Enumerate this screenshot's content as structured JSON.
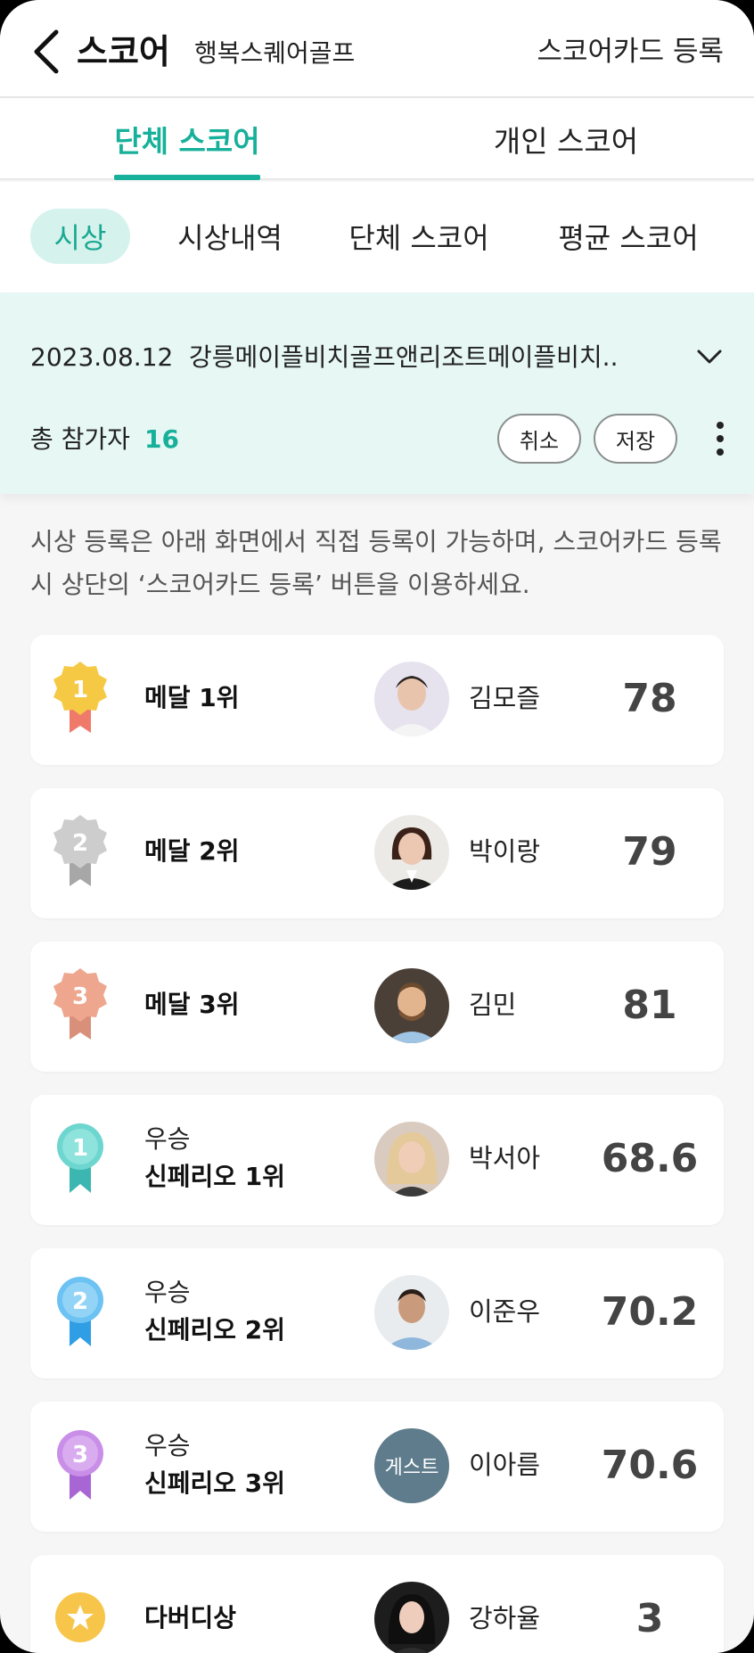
{
  "header": {
    "title": "스코어",
    "club_name": "행복스퀘어골프",
    "register_label": "스코어카드 등록"
  },
  "main_tabs": [
    {
      "label": "단체 스코어",
      "active": true
    },
    {
      "label": "개인 스코어",
      "active": false
    }
  ],
  "sub_tabs": [
    {
      "label": "시상",
      "active": true
    },
    {
      "label": "시상내역",
      "active": false
    },
    {
      "label": "단체 스코어",
      "active": false
    },
    {
      "label": "평균 스코어",
      "active": false
    }
  ],
  "event": {
    "date": "2023.08.12",
    "name": "강릉메이플비치골프앤리조트메이플비치..",
    "participants_label": "총 참가자",
    "participants_count": "16",
    "cancel_label": "취소",
    "save_label": "저장"
  },
  "notice": "시상 등록은 아래 화면에서 직접 등록이 가능하며, 스코어카드 등록시 상단의 ‘스코어카드 등록’ 버튼을 이용하세요.",
  "awards": [
    {
      "category": "",
      "label": "메달 1위",
      "player": "김모즐",
      "score": "78",
      "medal_icon": "gold-medal-icon",
      "color": "#f6c945"
    },
    {
      "category": "",
      "label": "메달 2위",
      "player": "박이랑",
      "score": "79",
      "medal_icon": "silver-medal-icon",
      "color": "#c9c9c9"
    },
    {
      "category": "",
      "label": "메달 3위",
      "player": "김민",
      "score": "81",
      "medal_icon": "bronze-medal-icon",
      "color": "#eea78e"
    },
    {
      "category": "우승",
      "label": "신페리오 1위",
      "player": "박서아",
      "score": "68.6",
      "medal_icon": "teal-ribbon-icon",
      "color": "#6dd6cf"
    },
    {
      "category": "우승",
      "label": "신페리오 2위",
      "player": "이준우",
      "score": "70.2",
      "medal_icon": "blue-ribbon-icon",
      "color": "#6cc2f2"
    },
    {
      "category": "우승",
      "label": "신페리오 3위",
      "player": "이아름",
      "score": "70.6",
      "medal_icon": "purple-ribbon-icon",
      "color": "#c98fe8",
      "avatar_text": "게스트"
    },
    {
      "category": "",
      "label": "다버디상",
      "player": "강하율",
      "score": "3",
      "medal_icon": "star-icon",
      "color": "#f7c54a"
    }
  ]
}
